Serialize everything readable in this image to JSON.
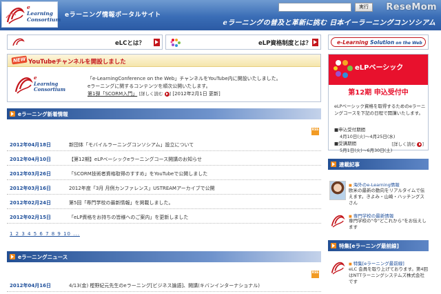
{
  "header": {
    "logo": {
      "line1": "e",
      "line2": "Learning",
      "line3": "Consortium"
    },
    "portal_title": "eラーニング情報ポータルサイト",
    "search": {
      "placeholder": "",
      "button_label": "実行"
    },
    "tagline": "eラーニングの普及と革新に挑む 日本イーラーニングコンソシアム",
    "watermark": "ReseMom"
  },
  "nav": {
    "elc_label": "eLCとは？",
    "elp_label": "eLP資格制度とは？",
    "solution_label_1": "e-Learning",
    "solution_label_2": " Solution",
    "solution_label_3": " on the Web"
  },
  "feature": {
    "badge": "NEW",
    "title": "YouTubeチャンネルを開設しました",
    "logo": {
      "line1": "e",
      "line2": "Learning",
      "line3": "Consortium"
    },
    "desc_line1": "「e-LearningConference on the Web」チャンネルをYouTube内に開設いたしました。",
    "desc_line2": "eラーニングに関するコンテンツを順次公開いたします。",
    "desc_line3_link": "第1弾「SCORM入門」",
    "more_label": "[詳しく読む",
    "desc_line3_date": "[2012年2月1日 更新]"
  },
  "news_section": {
    "title": "eラーニング新着情報",
    "rss_label": "RSS",
    "items": [
      {
        "date": "2012年04月18日",
        "text": "新団体「モバイルラーニングコンソシアム」設立について"
      },
      {
        "date": "2012年04月10日",
        "text": "【第12期】eLPベーシックeラーニングコース開講のお知らせ"
      },
      {
        "date": "2012年03月26日",
        "text": "「SCORM技術者資格取得のすすめ」をYouTubeで公開しました"
      },
      {
        "date": "2012年03月16日",
        "text": "2012年度「3月 月例カンファレンス」USTREAMアーカイブで公開"
      },
      {
        "date": "2012年02月24日",
        "text": "第5回「専門学校の最新情報」を掲載しました。"
      },
      {
        "date": "2012年02月15日",
        "text": "「eLP資格をお持ちの皆様へのご案内」を更新しました"
      }
    ],
    "pager": "1 2 3 4 5 6 7 8 9 10 ..."
  },
  "news2_section": {
    "title": "eラーニングニュース",
    "rss_label": "RSS",
    "items": [
      {
        "date": "2012年04月16日",
        "text": "4/13(金) 樫野紀元先生のeラーニング[ビジネス論語]、開講(キバンインターナショナル)"
      }
    ]
  },
  "elp": {
    "title": "eLPベーシック",
    "subtitle": "第12期 申込受付中",
    "desc": "eLPベーシック資格を取得するためのeラーニングコースを下記の日程で開講いたします。",
    "apply_label": "■申込受付期間",
    "apply_period": "4月10日(火)～4月25日(水)",
    "course_label": "■受講期間",
    "course_period": "5月1日(火)～6月30日(土)",
    "more_label": "[詳しく読む"
  },
  "serial": {
    "title": "連載記事",
    "entry1_title": "海外のe-Learning情報",
    "entry1_desc": "欧米の最新の動向をリアルタイムで伝えます。きよみ・山崎・ハッチングスさん",
    "entry2_title": "専門学校の最新情報",
    "entry2_desc": "専門学校の\"今\"どこれから\"をお伝えします"
  },
  "special": {
    "title": "特集[eラーニング最前線]",
    "entry1_title": "特集[eラーニング最前線]",
    "entry1_desc": "eLC 会員を取り上げております。第4回はNTTラーニングシステムズ株式会社です"
  },
  "colors": {
    "header_blue": "#3a6db6",
    "brand_red": "#c4161c",
    "link_blue": "#1d4e9a",
    "elp_red": "#e8112d"
  }
}
